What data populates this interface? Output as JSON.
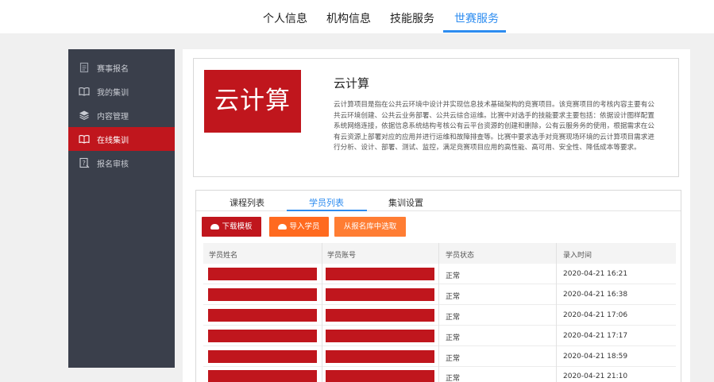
{
  "topnav": {
    "tabs": [
      "个人信息",
      "机构信息",
      "技能服务",
      "世赛服务"
    ],
    "active_index": 3
  },
  "sidebar": {
    "items": [
      {
        "label": "赛事报名",
        "icon": "document-icon"
      },
      {
        "label": "我的集训",
        "icon": "open-book-icon"
      },
      {
        "label": "内容管理",
        "icon": "layers-icon"
      },
      {
        "label": "在线集训",
        "icon": "open-book-icon"
      },
      {
        "label": "报名审核",
        "icon": "review-icon"
      }
    ],
    "active_index": 3
  },
  "project": {
    "banner_text": "云计算",
    "title": "云计算",
    "description": "云计算项目是指在公共云环境中设计并实现信息技术基础架构的竞赛项目。该竞赛项目的考核内容主要有公共云环境创建、公共云业务部署、公共云综合运维。比赛中对选手的技能要求主要包括：依据设计图样配置系统网络连接，依据信息系统结构考核公有云平台资源的创建和删除，公有云服务务的使用，根据需求在公有云资源上部署对应的应用并进行运维和故障排查等。比赛中要求选手对竞赛现场环境的云计算项目需求进行分析、设计、部署、测试、监控，满足竞赛项目应用的高性能、高可用、安全性、降低成本等要求。"
  },
  "subtabs": {
    "labels": [
      "课程列表",
      "学员列表",
      "集训设置"
    ],
    "active_index": 1
  },
  "actions": {
    "download_template": "下载模板",
    "import_students": "导入学员",
    "select_from_registry": "从报名库中选取"
  },
  "colors": {
    "accent": "#2d8cf0",
    "brand_red": "#c0161d",
    "orange": "#ff6a1f",
    "orange_light": "#ff7d33",
    "sidebar_bg": "#3a3f4b"
  },
  "table": {
    "columns": [
      "学员姓名",
      "学员账号",
      "学员状态",
      "录入时间"
    ],
    "rows": [
      {
        "status": "正常",
        "time": "2020-04-21 16:21"
      },
      {
        "status": "正常",
        "time": "2020-04-21 16:38"
      },
      {
        "status": "正常",
        "time": "2020-04-21 17:06"
      },
      {
        "status": "正常",
        "time": "2020-04-21 17:17"
      },
      {
        "status": "正常",
        "time": "2020-04-21 18:59"
      },
      {
        "status": "正常",
        "time": "2020-04-21 21:10"
      }
    ]
  }
}
